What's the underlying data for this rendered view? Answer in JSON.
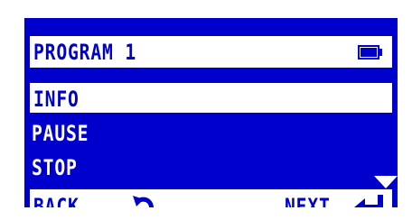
{
  "header": {
    "title": "PROGRAM 1",
    "battery_icon": "battery-icon"
  },
  "menu": {
    "items": [
      {
        "label": "INFO",
        "selected": true
      },
      {
        "label": "PAUSE",
        "selected": false
      },
      {
        "label": "STOP",
        "selected": false
      }
    ],
    "scroll_icon": "triangle-down-icon"
  },
  "footer": {
    "back_label": "BACK",
    "back_icon": "rotate-back-icon",
    "next_label": "NEXT",
    "next_icon": "enter-arrow-icon"
  },
  "colors": {
    "screen_bg": "#0000cc",
    "fg": "#ffffff"
  }
}
